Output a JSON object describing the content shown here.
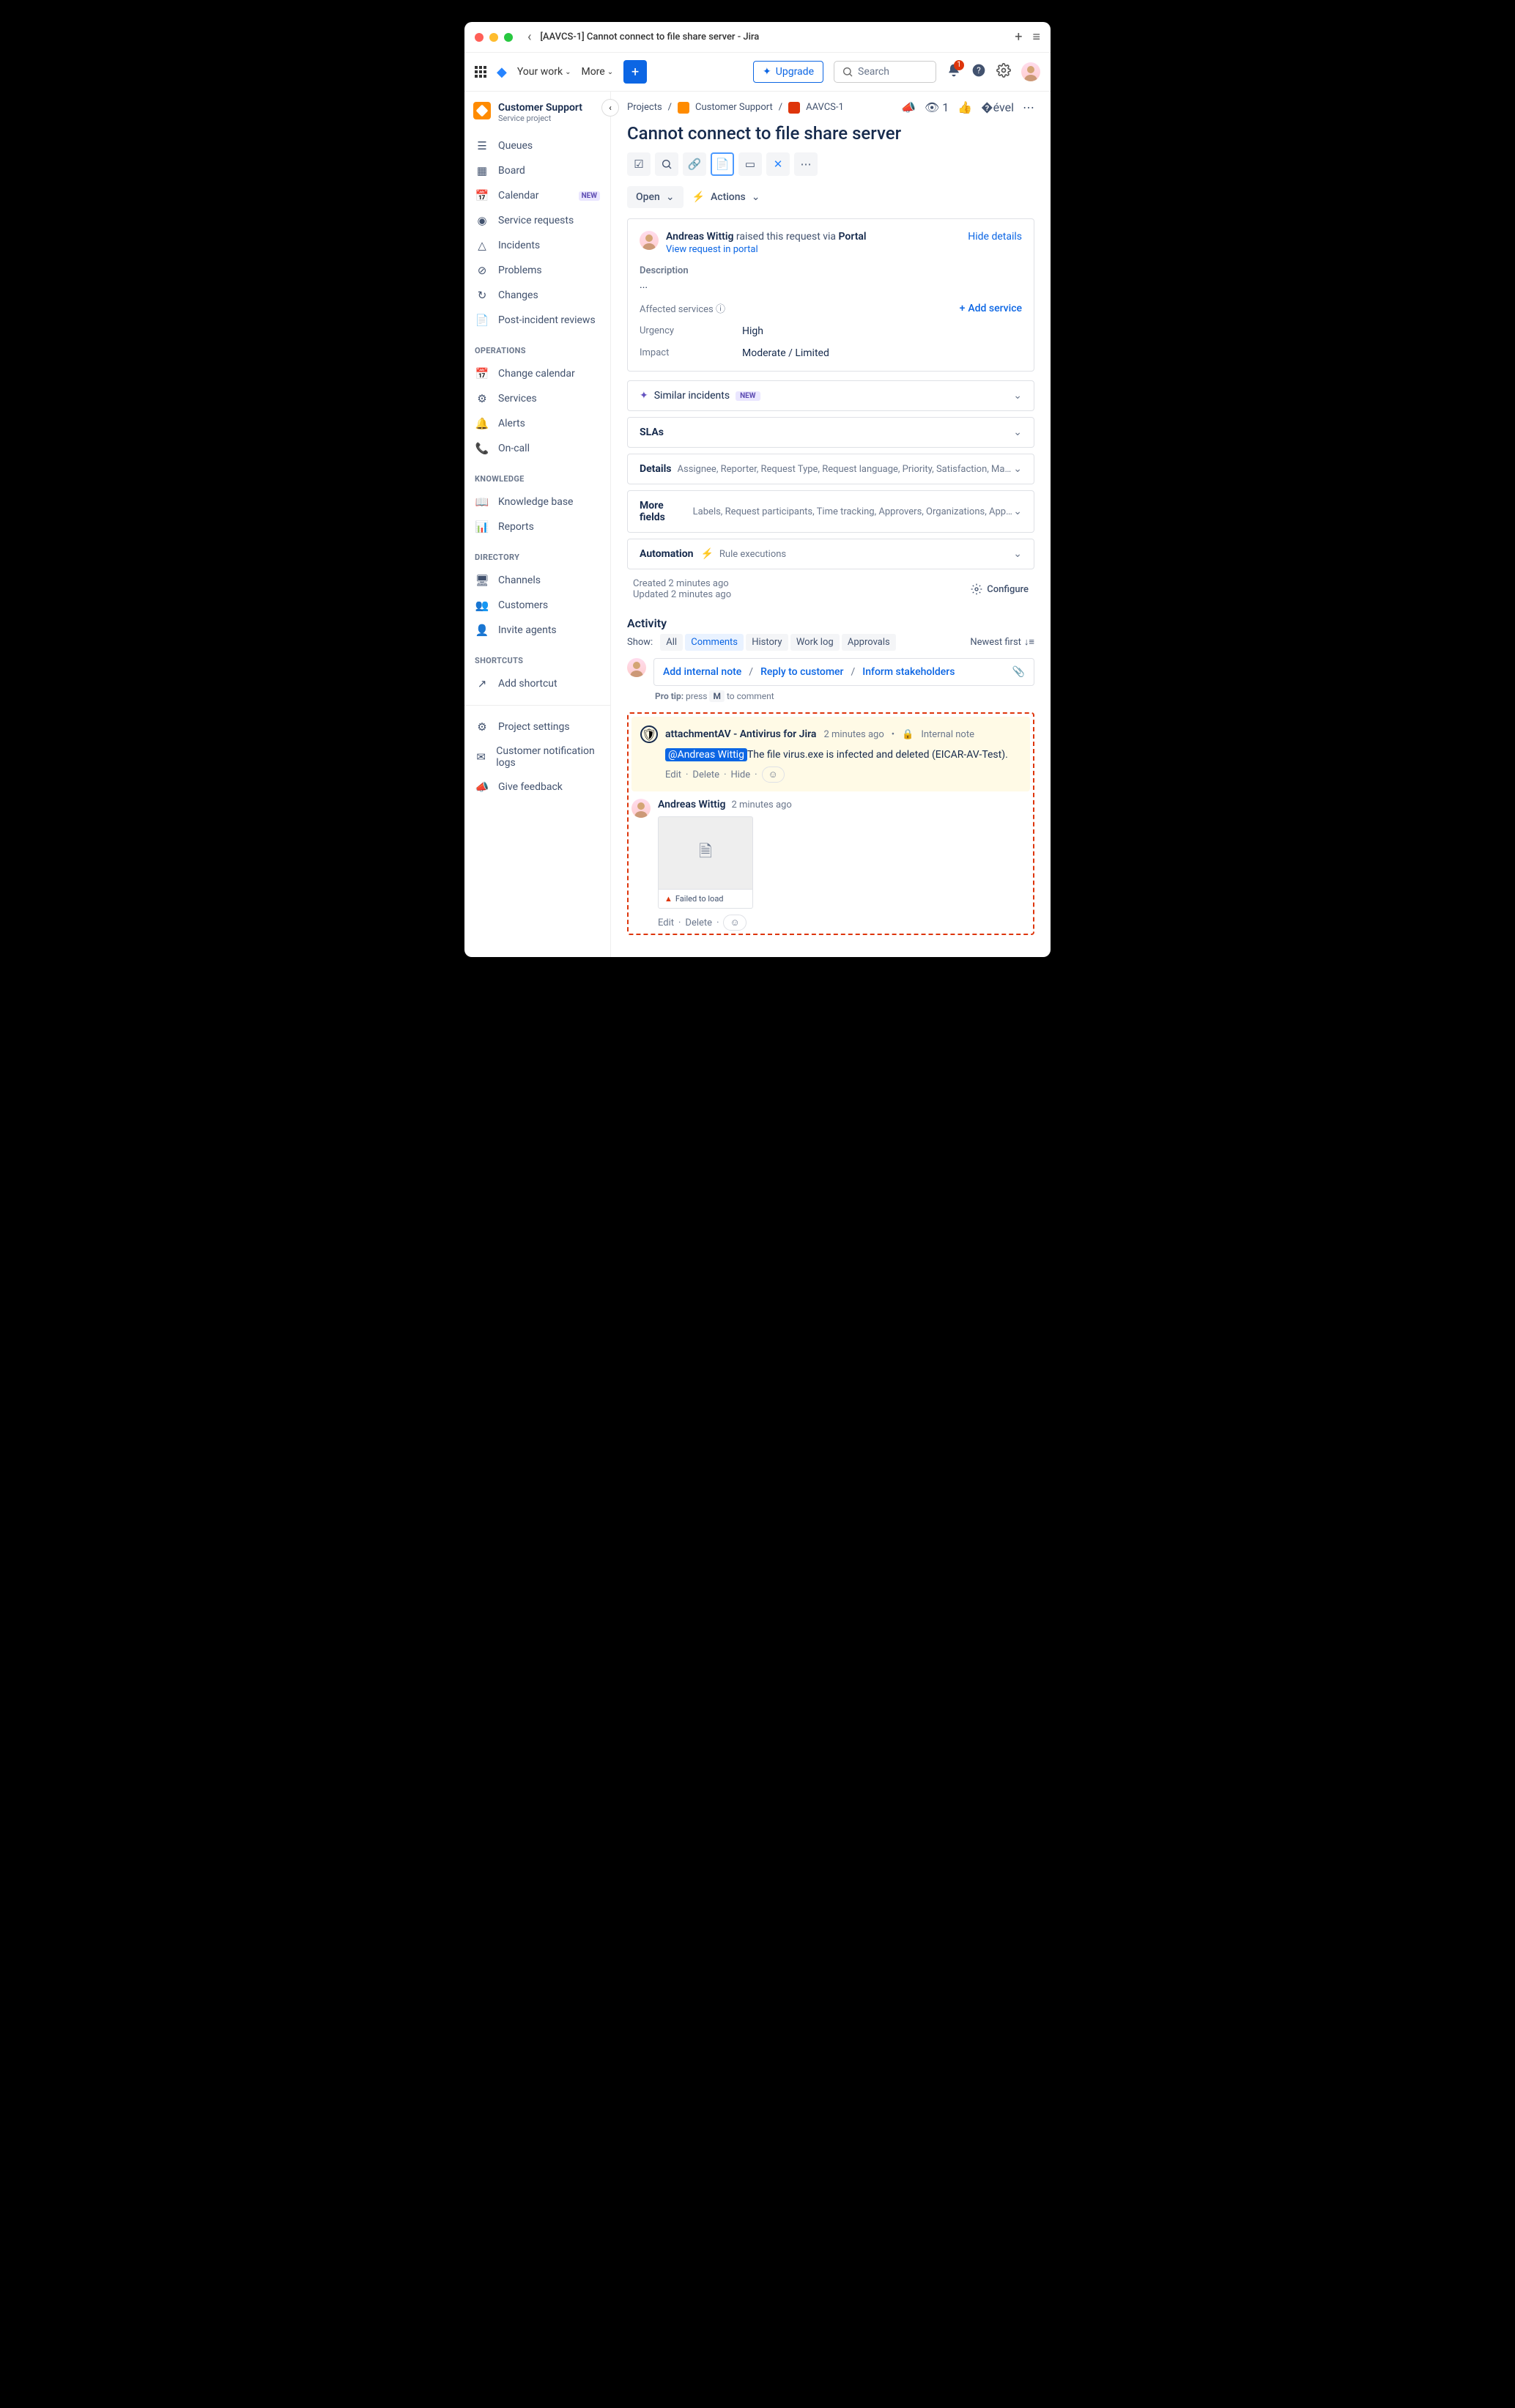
{
  "window": {
    "title": "[AAVCS-1] Cannot connect to file share server - Jira"
  },
  "topnav": {
    "yourwork": "Your work",
    "more": "More",
    "upgrade": "Upgrade",
    "search_placeholder": "Search",
    "notif_count": "1"
  },
  "project": {
    "name": "Customer Support",
    "type": "Service project"
  },
  "sidebar": {
    "items1": [
      {
        "label": "Queues"
      },
      {
        "label": "Board"
      },
      {
        "label": "Calendar",
        "new": true
      },
      {
        "label": "Service requests"
      },
      {
        "label": "Incidents"
      },
      {
        "label": "Problems"
      },
      {
        "label": "Changes"
      },
      {
        "label": "Post-incident reviews"
      }
    ],
    "ops_title": "OPERATIONS",
    "ops": [
      {
        "label": "Change calendar"
      },
      {
        "label": "Services"
      },
      {
        "label": "Alerts"
      },
      {
        "label": "On-call"
      }
    ],
    "kn_title": "KNOWLEDGE",
    "kn": [
      {
        "label": "Knowledge base"
      },
      {
        "label": "Reports"
      }
    ],
    "dir_title": "DIRECTORY",
    "dir": [
      {
        "label": "Channels"
      },
      {
        "label": "Customers"
      },
      {
        "label": "Invite agents"
      }
    ],
    "sc_title": "SHORTCUTS",
    "sc": [
      {
        "label": "Add shortcut"
      }
    ],
    "bottom": [
      {
        "label": "Project settings"
      },
      {
        "label": "Customer notification logs"
      },
      {
        "label": "Give feedback"
      }
    ]
  },
  "breadcrumb": {
    "projects": "Projects",
    "proj": "Customer Support",
    "key": "AAVCS-1",
    "watch": "1"
  },
  "issue": {
    "title": "Cannot connect to file share server"
  },
  "status": {
    "open": "Open",
    "actions": "Actions"
  },
  "request": {
    "raised_by": "Andreas Wittig",
    "raised_txt": " raised this request via ",
    "channel": "Portal",
    "view": "View request in portal",
    "hide": "Hide details",
    "desc_label": "Description",
    "desc": "...",
    "aff_label": "Affected services",
    "add_svc": "Add service",
    "urgency_l": "Urgency",
    "urgency_v": "High",
    "impact_l": "Impact",
    "impact_v": "Moderate / Limited"
  },
  "similar": {
    "label": "Similar incidents",
    "new": "NEW"
  },
  "accordions": {
    "slas": "SLAs",
    "details": "Details",
    "details_sub": "Assignee, Reporter, Request Type, Request language, Priority, Satisfaction, Major inciden...",
    "more": "More fields",
    "more_sub": "Labels, Request participants, Time tracking, Approvers, Organizations, Approver gr...",
    "auto": "Automation",
    "auto_sub": "Rule executions"
  },
  "meta": {
    "created": "Created 2 minutes ago",
    "updated": "Updated 2 minutes ago",
    "configure": "Configure"
  },
  "activity": {
    "header": "Activity",
    "show": "Show:",
    "tabs": [
      {
        "l": "All"
      },
      {
        "l": "Comments",
        "a": true
      },
      {
        "l": "History"
      },
      {
        "l": "Work log"
      },
      {
        "l": "Approvals"
      }
    ],
    "sort": "Newest first",
    "internal": "Add internal note",
    "reply": "Reply to customer",
    "inform": "Inform stakeholders",
    "protip_pre": "Pro tip:",
    "protip_press": " press ",
    "protip_key": "M",
    "protip_post": " to comment"
  },
  "note": {
    "app": "attachmentAV - Antivirus for Jira",
    "time": "2 minutes ago",
    "kind": "Internal note",
    "mention": "@Andreas Wittig",
    "msg": "The file virus.exe is infected and deleted (EICAR-AV-Test).",
    "edit": "Edit",
    "del": "Delete",
    "hide": "Hide"
  },
  "comment2": {
    "author": "Andreas Wittig",
    "time": "2 minutes ago",
    "fail": "Failed to load",
    "edit": "Edit",
    "del": "Delete"
  },
  "new_label": "NEW"
}
